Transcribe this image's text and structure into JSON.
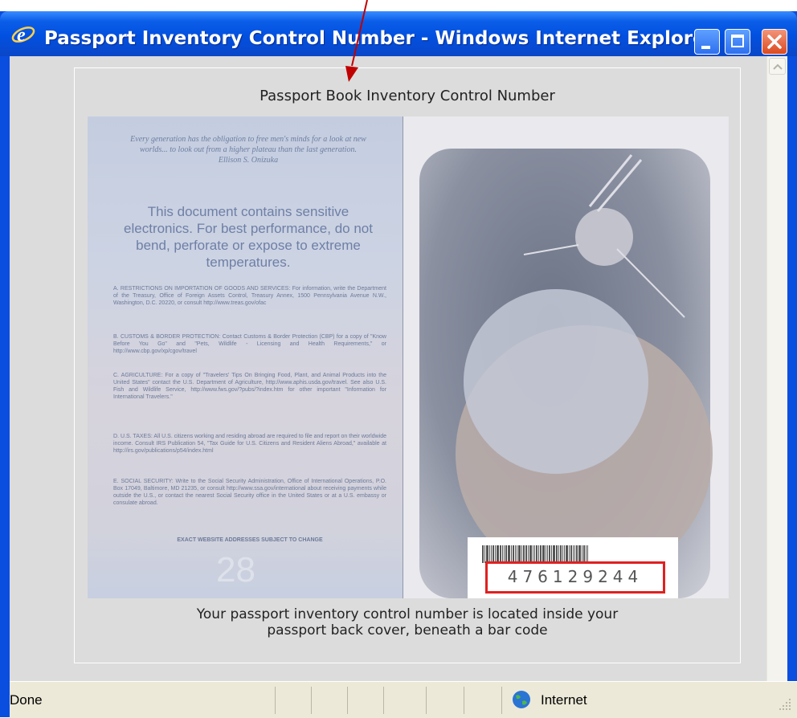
{
  "window": {
    "title": "Passport Inventory Control Number - Windows Internet Explorer",
    "buttons": {
      "minimize": "minimize-icon",
      "maximize": "maximize-icon",
      "close": "close-icon"
    }
  },
  "page": {
    "title": "Passport Book Inventory Control Number",
    "caption_line1": "Your passport inventory control number is located inside your",
    "caption_line2": "passport back cover, beneath a bar code"
  },
  "passport": {
    "quote": "Every generation has the obligation to free men's minds for a look at new worlds... to look out from a higher plateau than the last generation.",
    "quote_author": "Ellison S. Onizuka",
    "notice": "This document contains sensitive electronics. For best performance, do not bend, perforate or expose to extreme temperatures.",
    "section_a": "A. RESTRICTIONS ON IMPORTATION OF GOODS AND SERVICES: For information, write the Department of the Treasury, Office of Foreign Assets Control, Treasury Annex, 1500 Pennsylvania Avenue N.W., Washington, D.C. 20220, or consult http://www.treas.gov/ofac",
    "section_b": "B. CUSTOMS & BORDER PROTECTION: Contact Customs & Border Protection (CBP) for a copy of \"Know Before You Go\" and \"Pets, Wildlife - Licensing and Health Requirements,\" or http://www.cbp.gov/xp/cgov/travel",
    "section_c": "C. AGRICULTURE: For a copy of \"Travelers' Tips On Bringing Food, Plant, and Animal Products into the United States\" contact the U.S. Department of Agriculture, http://www.aphis.usda.gov/travel. See also U.S. Fish and Wildlife Service, http://www.fws.gov/?pubs/?index.htm for other important \"Information for International Travelers.\"",
    "section_d": "D. U.S. TAXES: All U.S. citizens working and residing abroad are required to file and report on their worldwide income. Consult IRS Publication 54, \"Tax Guide for U.S. Citizens and Resident Aliens Abroad,\" available at http://irs.gov/publications/p54/index.html",
    "section_e": "E. SOCIAL SECURITY: Write to the Social Security Administration, Office of International Operations, P.O. Box 17049, Baltimore, MD 21235, or consult http://www.ssa.gov/international about receiving payments while outside the U.S., or contact the nearest Social Security office in the United States or at a U.S. embassy or consulate abroad.",
    "disclaimer": "EXACT WEBSITE ADDRESSES SUBJECT TO CHANGE",
    "page_number": "28",
    "inventory_number": "476129244"
  },
  "statusbar": {
    "status": "Done",
    "zone": "Internet",
    "zone_icon": "globe-icon"
  },
  "colors": {
    "title_bar": "#0250e0",
    "close_button": "#dc4a20",
    "highlight_box": "#e02020",
    "annotation_arrow": "#c00000"
  }
}
